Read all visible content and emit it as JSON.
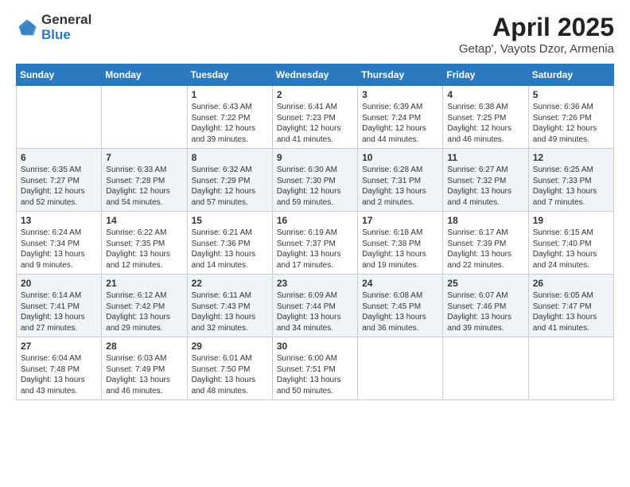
{
  "header": {
    "logo_general": "General",
    "logo_blue": "Blue",
    "title": "April 2025",
    "location": "Getap', Vayots Dzor, Armenia"
  },
  "weekdays": [
    "Sunday",
    "Monday",
    "Tuesday",
    "Wednesday",
    "Thursday",
    "Friday",
    "Saturday"
  ],
  "weeks": [
    [
      {
        "day": "",
        "sunrise": "",
        "sunset": "",
        "daylight": ""
      },
      {
        "day": "",
        "sunrise": "",
        "sunset": "",
        "daylight": ""
      },
      {
        "day": "1",
        "sunrise": "Sunrise: 6:43 AM",
        "sunset": "Sunset: 7:22 PM",
        "daylight": "Daylight: 12 hours and 39 minutes."
      },
      {
        "day": "2",
        "sunrise": "Sunrise: 6:41 AM",
        "sunset": "Sunset: 7:23 PM",
        "daylight": "Daylight: 12 hours and 41 minutes."
      },
      {
        "day": "3",
        "sunrise": "Sunrise: 6:39 AM",
        "sunset": "Sunset: 7:24 PM",
        "daylight": "Daylight: 12 hours and 44 minutes."
      },
      {
        "day": "4",
        "sunrise": "Sunrise: 6:38 AM",
        "sunset": "Sunset: 7:25 PM",
        "daylight": "Daylight: 12 hours and 46 minutes."
      },
      {
        "day": "5",
        "sunrise": "Sunrise: 6:36 AM",
        "sunset": "Sunset: 7:26 PM",
        "daylight": "Daylight: 12 hours and 49 minutes."
      }
    ],
    [
      {
        "day": "6",
        "sunrise": "Sunrise: 6:35 AM",
        "sunset": "Sunset: 7:27 PM",
        "daylight": "Daylight: 12 hours and 52 minutes."
      },
      {
        "day": "7",
        "sunrise": "Sunrise: 6:33 AM",
        "sunset": "Sunset: 7:28 PM",
        "daylight": "Daylight: 12 hours and 54 minutes."
      },
      {
        "day": "8",
        "sunrise": "Sunrise: 6:32 AM",
        "sunset": "Sunset: 7:29 PM",
        "daylight": "Daylight: 12 hours and 57 minutes."
      },
      {
        "day": "9",
        "sunrise": "Sunrise: 6:30 AM",
        "sunset": "Sunset: 7:30 PM",
        "daylight": "Daylight: 12 hours and 59 minutes."
      },
      {
        "day": "10",
        "sunrise": "Sunrise: 6:28 AM",
        "sunset": "Sunset: 7:31 PM",
        "daylight": "Daylight: 13 hours and 2 minutes."
      },
      {
        "day": "11",
        "sunrise": "Sunrise: 6:27 AM",
        "sunset": "Sunset: 7:32 PM",
        "daylight": "Daylight: 13 hours and 4 minutes."
      },
      {
        "day": "12",
        "sunrise": "Sunrise: 6:25 AM",
        "sunset": "Sunset: 7:33 PM",
        "daylight": "Daylight: 13 hours and 7 minutes."
      }
    ],
    [
      {
        "day": "13",
        "sunrise": "Sunrise: 6:24 AM",
        "sunset": "Sunset: 7:34 PM",
        "daylight": "Daylight: 13 hours and 9 minutes."
      },
      {
        "day": "14",
        "sunrise": "Sunrise: 6:22 AM",
        "sunset": "Sunset: 7:35 PM",
        "daylight": "Daylight: 13 hours and 12 minutes."
      },
      {
        "day": "15",
        "sunrise": "Sunrise: 6:21 AM",
        "sunset": "Sunset: 7:36 PM",
        "daylight": "Daylight: 13 hours and 14 minutes."
      },
      {
        "day": "16",
        "sunrise": "Sunrise: 6:19 AM",
        "sunset": "Sunset: 7:37 PM",
        "daylight": "Daylight: 13 hours and 17 minutes."
      },
      {
        "day": "17",
        "sunrise": "Sunrise: 6:18 AM",
        "sunset": "Sunset: 7:38 PM",
        "daylight": "Daylight: 13 hours and 19 minutes."
      },
      {
        "day": "18",
        "sunrise": "Sunrise: 6:17 AM",
        "sunset": "Sunset: 7:39 PM",
        "daylight": "Daylight: 13 hours and 22 minutes."
      },
      {
        "day": "19",
        "sunrise": "Sunrise: 6:15 AM",
        "sunset": "Sunset: 7:40 PM",
        "daylight": "Daylight: 13 hours and 24 minutes."
      }
    ],
    [
      {
        "day": "20",
        "sunrise": "Sunrise: 6:14 AM",
        "sunset": "Sunset: 7:41 PM",
        "daylight": "Daylight: 13 hours and 27 minutes."
      },
      {
        "day": "21",
        "sunrise": "Sunrise: 6:12 AM",
        "sunset": "Sunset: 7:42 PM",
        "daylight": "Daylight: 13 hours and 29 minutes."
      },
      {
        "day": "22",
        "sunrise": "Sunrise: 6:11 AM",
        "sunset": "Sunset: 7:43 PM",
        "daylight": "Daylight: 13 hours and 32 minutes."
      },
      {
        "day": "23",
        "sunrise": "Sunrise: 6:09 AM",
        "sunset": "Sunset: 7:44 PM",
        "daylight": "Daylight: 13 hours and 34 minutes."
      },
      {
        "day": "24",
        "sunrise": "Sunrise: 6:08 AM",
        "sunset": "Sunset: 7:45 PM",
        "daylight": "Daylight: 13 hours and 36 minutes."
      },
      {
        "day": "25",
        "sunrise": "Sunrise: 6:07 AM",
        "sunset": "Sunset: 7:46 PM",
        "daylight": "Daylight: 13 hours and 39 minutes."
      },
      {
        "day": "26",
        "sunrise": "Sunrise: 6:05 AM",
        "sunset": "Sunset: 7:47 PM",
        "daylight": "Daylight: 13 hours and 41 minutes."
      }
    ],
    [
      {
        "day": "27",
        "sunrise": "Sunrise: 6:04 AM",
        "sunset": "Sunset: 7:48 PM",
        "daylight": "Daylight: 13 hours and 43 minutes."
      },
      {
        "day": "28",
        "sunrise": "Sunrise: 6:03 AM",
        "sunset": "Sunset: 7:49 PM",
        "daylight": "Daylight: 13 hours and 46 minutes."
      },
      {
        "day": "29",
        "sunrise": "Sunrise: 6:01 AM",
        "sunset": "Sunset: 7:50 PM",
        "daylight": "Daylight: 13 hours and 48 minutes."
      },
      {
        "day": "30",
        "sunrise": "Sunrise: 6:00 AM",
        "sunset": "Sunset: 7:51 PM",
        "daylight": "Daylight: 13 hours and 50 minutes."
      },
      {
        "day": "",
        "sunrise": "",
        "sunset": "",
        "daylight": ""
      },
      {
        "day": "",
        "sunrise": "",
        "sunset": "",
        "daylight": ""
      },
      {
        "day": "",
        "sunrise": "",
        "sunset": "",
        "daylight": ""
      }
    ]
  ]
}
